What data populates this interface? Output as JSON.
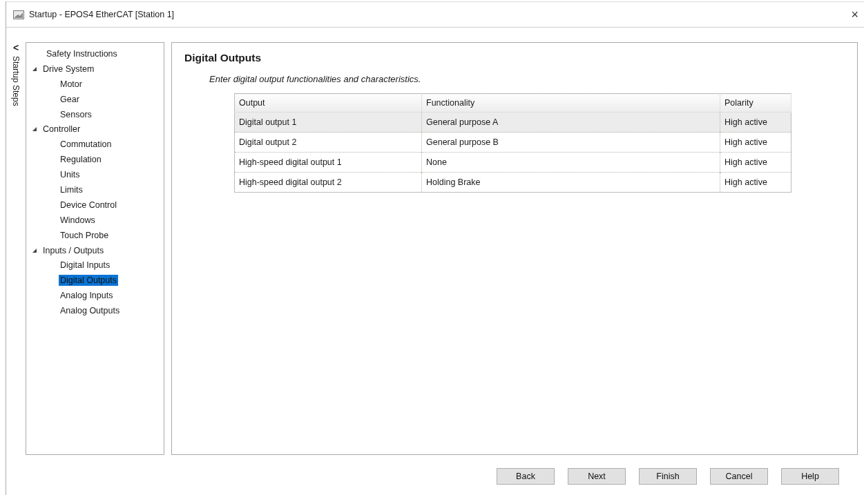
{
  "window": {
    "title": "Startup - EPOS4 EtherCAT [Station 1]",
    "close": "×"
  },
  "side_strip": {
    "collapse": "<",
    "label": "Startup Steps"
  },
  "tree": [
    {
      "label": "Safety Instructions",
      "selected": false
    },
    {
      "label": "Drive System",
      "expanded": true,
      "selected": false,
      "children": [
        {
          "label": "Motor",
          "selected": false
        },
        {
          "label": "Gear",
          "selected": false
        },
        {
          "label": "Sensors",
          "selected": false
        }
      ]
    },
    {
      "label": "Controller",
      "expanded": true,
      "selected": false,
      "children": [
        {
          "label": "Commutation",
          "selected": false
        },
        {
          "label": "Regulation",
          "selected": false
        },
        {
          "label": "Units",
          "selected": false
        },
        {
          "label": "Limits",
          "selected": false
        },
        {
          "label": "Device Control",
          "selected": false
        },
        {
          "label": "Windows",
          "selected": false
        },
        {
          "label": "Touch Probe",
          "selected": false
        }
      ]
    },
    {
      "label": "Inputs / Outputs",
      "expanded": true,
      "selected": false,
      "children": [
        {
          "label": "Digital Inputs",
          "selected": false
        },
        {
          "label": "Digital Outputs",
          "selected": true
        },
        {
          "label": "Analog Inputs",
          "selected": false
        },
        {
          "label": "Analog Outputs",
          "selected": false
        }
      ]
    }
  ],
  "page": {
    "heading": "Digital Outputs",
    "instruction": "Enter digital output functionalities and characteristics."
  },
  "table": {
    "columns": [
      "Output",
      "Functionality",
      "Polarity"
    ],
    "rows": [
      {
        "cells": [
          "Digital output 1",
          "General purpose A",
          "High active"
        ],
        "selected": true
      },
      {
        "cells": [
          "Digital output 2",
          "General purpose B",
          "High active"
        ],
        "selected": false
      },
      {
        "cells": [
          "High-speed digital output 1",
          "None",
          "High active"
        ],
        "selected": false
      },
      {
        "cells": [
          "High-speed digital output 2",
          "Holding Brake",
          "High active"
        ],
        "selected": false
      }
    ]
  },
  "buttons": [
    "Back",
    "Next",
    "Finish",
    "Cancel",
    "Help"
  ]
}
